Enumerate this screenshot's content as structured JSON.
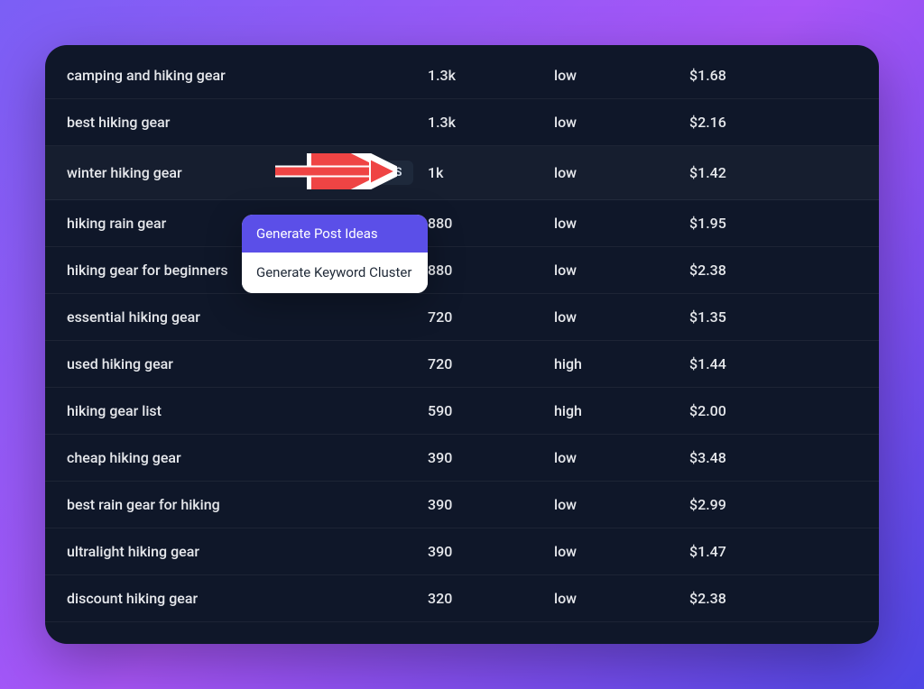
{
  "tools_label": "TOOLS",
  "highlighted_row_index": 2,
  "dropdown": {
    "items": [
      {
        "label": "Generate Post Ideas",
        "active": true
      },
      {
        "label": "Generate Keyword Cluster",
        "active": false
      }
    ]
  },
  "rows": [
    {
      "keyword": "camping and hiking gear",
      "volume": "1.3k",
      "competition": "low",
      "cpc": "$1.68"
    },
    {
      "keyword": "best hiking gear",
      "volume": "1.3k",
      "competition": "low",
      "cpc": "$2.16"
    },
    {
      "keyword": "winter hiking gear",
      "volume": "1k",
      "competition": "low",
      "cpc": "$1.42"
    },
    {
      "keyword": "hiking rain gear",
      "volume": "880",
      "competition": "low",
      "cpc": "$1.95"
    },
    {
      "keyword": "hiking gear for beginners",
      "volume": "880",
      "competition": "low",
      "cpc": "$2.38"
    },
    {
      "keyword": "essential hiking gear",
      "volume": "720",
      "competition": "low",
      "cpc": "$1.35"
    },
    {
      "keyword": "used hiking gear",
      "volume": "720",
      "competition": "high",
      "cpc": "$1.44"
    },
    {
      "keyword": "hiking gear list",
      "volume": "590",
      "competition": "high",
      "cpc": "$2.00"
    },
    {
      "keyword": "cheap hiking gear",
      "volume": "390",
      "competition": "low",
      "cpc": "$3.48"
    },
    {
      "keyword": "best rain gear for hiking",
      "volume": "390",
      "competition": "low",
      "cpc": "$2.99"
    },
    {
      "keyword": "ultralight hiking gear",
      "volume": "390",
      "competition": "low",
      "cpc": "$1.47"
    },
    {
      "keyword": "discount hiking gear",
      "volume": "320",
      "competition": "low",
      "cpc": "$2.38"
    }
  ]
}
